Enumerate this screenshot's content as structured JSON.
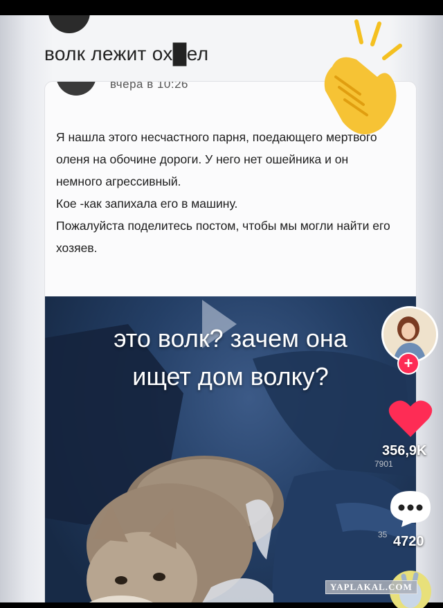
{
  "caption": {
    "text": "волк лежит ох█ел"
  },
  "post": {
    "time": "вчера в 10:26",
    "paragraphs": [
      "Я нашла этого несчастного парня, поедающего мертвого оленя на обочине дороги. У него нет ошейника и он немного агрессивный.",
      "Кое -как запихала его в машину.",
      "Пожалуйста поделитесь постом, чтобы мы могли найти его хозяев."
    ]
  },
  "video": {
    "overlay_line1": "это волк? зачем она",
    "overlay_line2": "ищет дом волку?"
  },
  "actions": {
    "follow_symbol": "+",
    "likes": "356,9K",
    "likes_ghost": "7901",
    "comments": "4720",
    "comments_ghost": "35"
  },
  "watermark": {
    "text": "YAPLAKAL.COM"
  },
  "icons": [
    "clapping-hands-icon",
    "play-icon",
    "heart-icon",
    "comment-icon",
    "avatar-image"
  ],
  "colors": {
    "accent": "#fe2c55",
    "clap": "#f4c020",
    "video_bg": "#243f66"
  }
}
